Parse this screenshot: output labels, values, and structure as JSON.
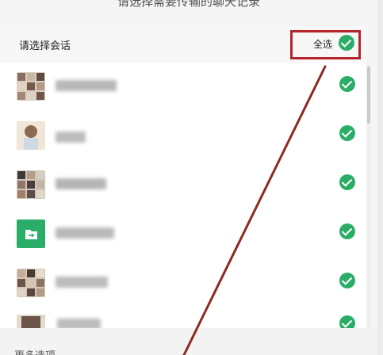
{
  "dialog": {
    "title_partial": "请选择需要传输的聊天记录",
    "select_label": "请选择会话",
    "select_all_label": "全选",
    "more_options_label": "更多选项"
  },
  "colors": {
    "check_green": "#2aae67",
    "highlight_red": "#b3262c",
    "arrow_red": "#8b2a22"
  },
  "conversations": [
    {
      "name": "群聊",
      "selected": true,
      "avatar": "group-grid"
    },
    {
      "name": "联系人",
      "selected": true,
      "avatar": "person-photo"
    },
    {
      "name": "群聊",
      "selected": true,
      "avatar": "group-grid"
    },
    {
      "name": "文件传输助手",
      "selected": true,
      "avatar": "file-transfer"
    },
    {
      "name": "群聊",
      "selected": true,
      "avatar": "group-grid"
    },
    {
      "name": "群聊",
      "selected": true,
      "avatar": "group-grid"
    }
  ]
}
